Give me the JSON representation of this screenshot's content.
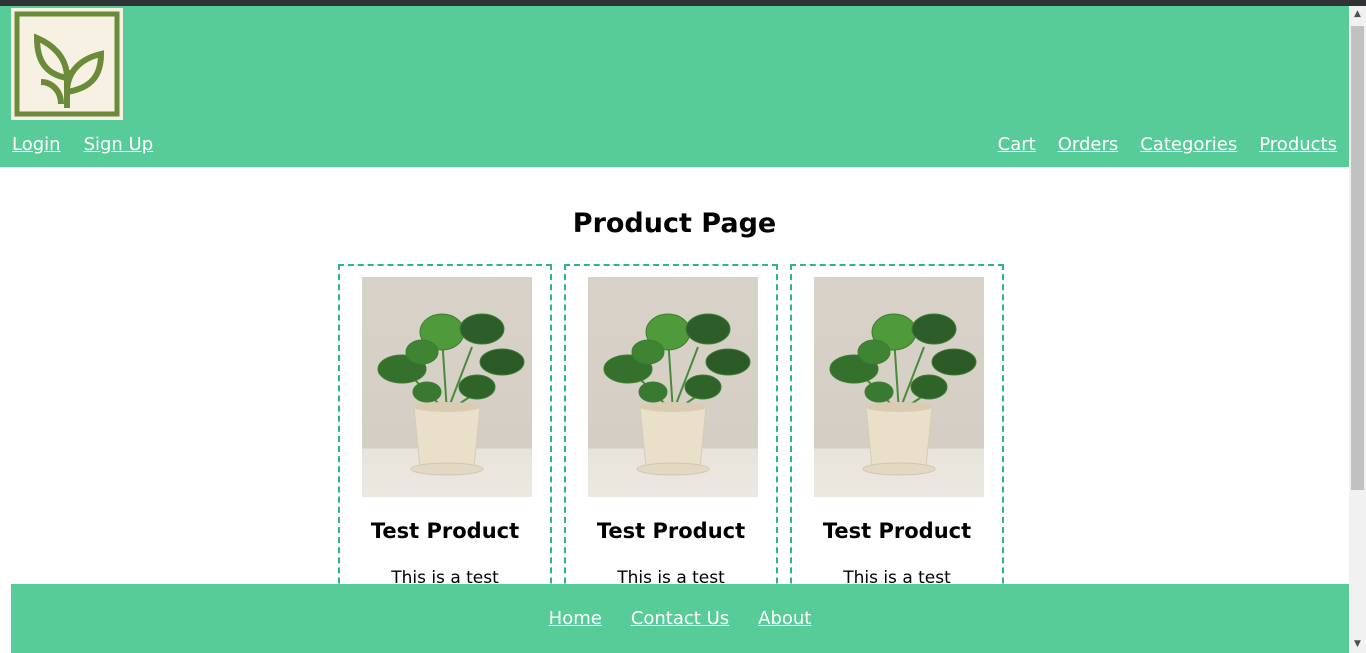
{
  "header": {
    "logo_icon": "sprout-leaf-logo-icon",
    "nav_left": [
      {
        "label": "Login"
      },
      {
        "label": "Sign Up"
      }
    ],
    "nav_right": [
      {
        "label": "Cart"
      },
      {
        "label": "Orders"
      },
      {
        "label": "Categories"
      },
      {
        "label": "Products"
      }
    ]
  },
  "main": {
    "title": "Product Page",
    "products": [
      {
        "name": "Test Product",
        "description": "This is a test",
        "image": "potted-plant-image"
      },
      {
        "name": "Test Product",
        "description": "This is a test",
        "image": "potted-plant-image"
      },
      {
        "name": "Test Product",
        "description": "This is a test",
        "image": "potted-plant-image"
      }
    ]
  },
  "footer": {
    "links": [
      {
        "label": "Home"
      },
      {
        "label": "Contact Us"
      },
      {
        "label": "About"
      }
    ]
  },
  "colors": {
    "brand_green": "#57cc99",
    "card_border": "#2fb38a",
    "logo_bg": "#f6f1e2",
    "logo_fg": "#6b8a3a"
  }
}
